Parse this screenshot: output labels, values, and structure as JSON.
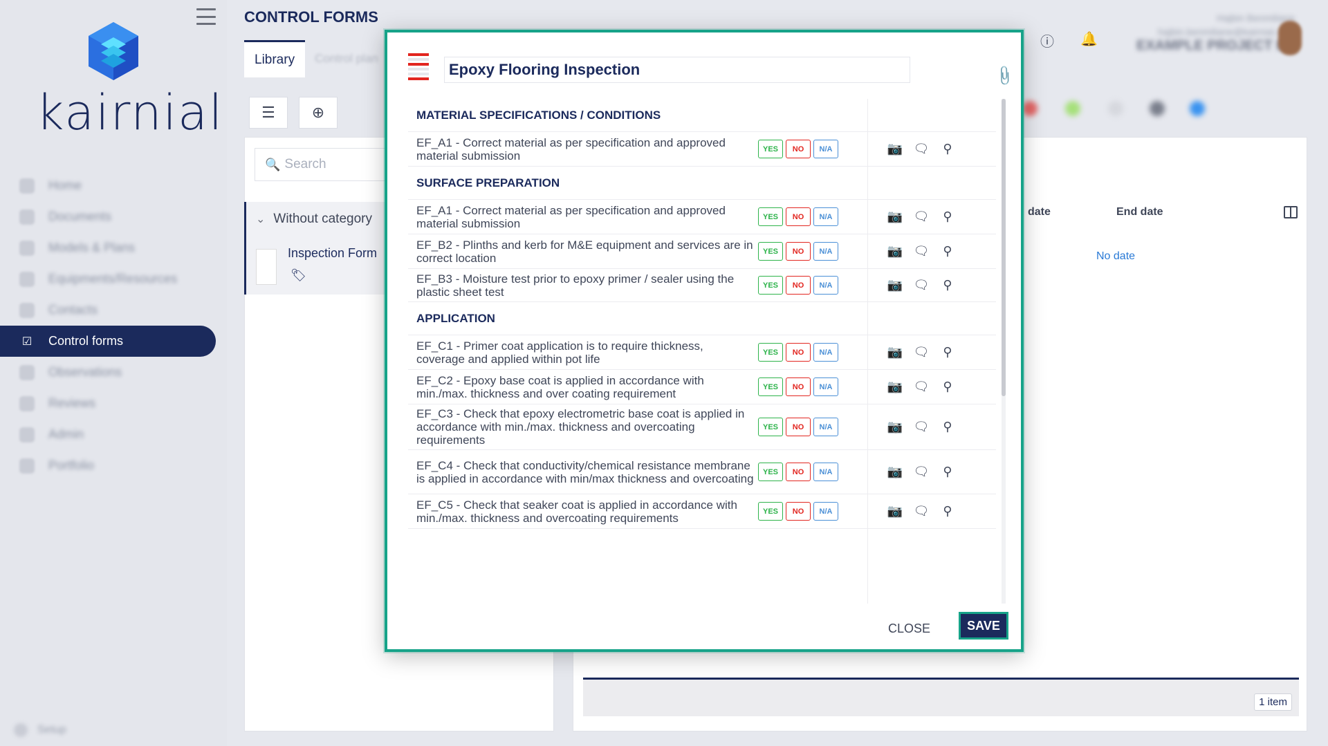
{
  "app": {
    "logo_text": "kairnial"
  },
  "nav": {
    "items": [
      {
        "label": "Home"
      },
      {
        "label": "Documents"
      },
      {
        "label": "Models & Plans"
      },
      {
        "label": "Equipments/Resources"
      },
      {
        "label": "Contacts"
      },
      {
        "label": "Control forms"
      },
      {
        "label": "Observations"
      },
      {
        "label": "Reviews"
      },
      {
        "label": "Admin"
      },
      {
        "label": "Portfolio"
      }
    ],
    "setup": "Setup"
  },
  "header": {
    "title": "CONTROL FORMS",
    "tabs": [
      "Library",
      "Control plan"
    ],
    "user_name": "Hajbin Benmiliane",
    "user_email": "hajbin.benmiliane@kairnial.com",
    "project": "EXAMPLE PROJECT EX"
  },
  "library": {
    "search_placeholder": "Search",
    "category": "Without category",
    "form_name": "Inspection Form"
  },
  "table": {
    "col_start": "date",
    "col_end": "End date",
    "end_value": "No date",
    "count": "1 item"
  },
  "modal": {
    "title": "Epoxy Flooring Inspection",
    "sections": [
      {
        "title": "MATERIAL SPECIFICATIONS / CONDITIONS",
        "items": [
          {
            "text": "EF_A1 - Correct material as per specification and approved material submission"
          }
        ]
      },
      {
        "title": "SURFACE PREPARATION",
        "items": [
          {
            "text": "EF_A1 - Correct material as per specification and approved material submission"
          },
          {
            "text": "EF_B2 - Plinths and kerb for M&E equipment and services are in correct location"
          },
          {
            "text": "EF_B3 - Moisture test prior to epoxy primer / sealer using the plastic sheet test"
          }
        ]
      },
      {
        "title": "APPLICATION",
        "items": [
          {
            "text": "EF_C1 - Primer coat application is to require thickness, coverage and applied within pot life"
          },
          {
            "text": "EF_C2 - Epoxy base coat is applied in accordance with min./max. thickness and over coating requirement"
          },
          {
            "text": "EF_C3 - Check that epoxy electrometric base coat is applied in accordance with min./max. thickness and overcoating requirements"
          },
          {
            "text": "EF_C4 - Check that conductivity/chemical resistance membrane is applied in accordance with min/max thickness and overcoating"
          },
          {
            "text": "EF_C5 - Check that seaker coat is applied in accordance with min./max. thickness and overcoating requirements"
          }
        ]
      }
    ],
    "yes": "YES",
    "no": "NO",
    "na": "N/A",
    "close": "CLOSE",
    "save": "SAVE"
  },
  "colors": {
    "brand": "#1b2a5c",
    "accent": "#17a389",
    "yes": "#2db34a",
    "no": "#e2251f",
    "na": "#4a8fd6"
  }
}
